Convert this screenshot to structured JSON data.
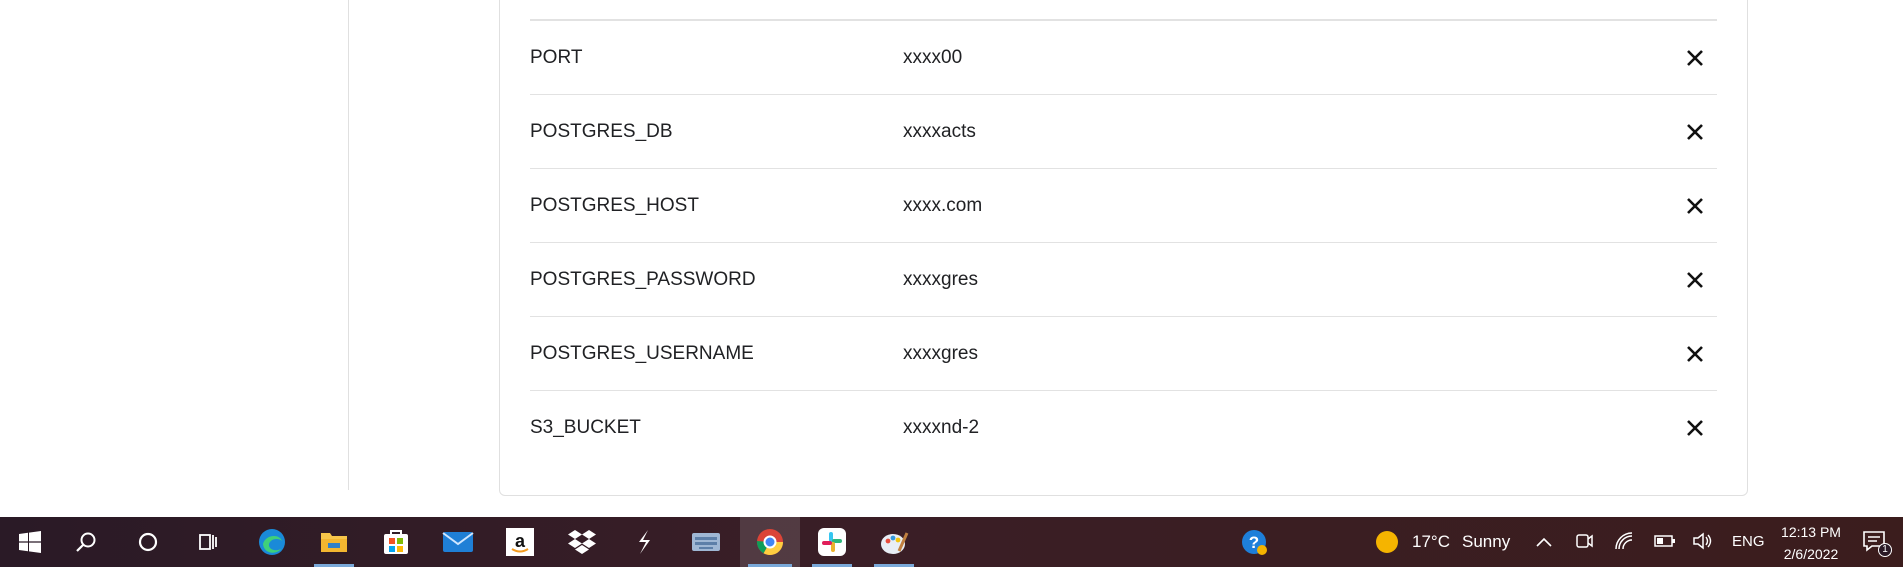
{
  "env_vars": [
    {
      "key": "PORT",
      "value": "xxxx00"
    },
    {
      "key": "POSTGRES_DB",
      "value": "xxxxacts"
    },
    {
      "key": "POSTGRES_HOST",
      "value": "xxxx.com"
    },
    {
      "key": "POSTGRES_PASSWORD",
      "value": "xxxxgres"
    },
    {
      "key": "POSTGRES_USERNAME",
      "value": "xxxxgres"
    },
    {
      "key": "S3_BUCKET",
      "value": "xxxxnd-2"
    }
  ],
  "taskbar": {
    "apps": [
      "start-icon",
      "search-icon",
      "cortana-icon",
      "task-view-icon",
      "edge-icon",
      "file-explorer-icon",
      "store-icon",
      "mail-icon",
      "amazon-icon",
      "dropbox-icon",
      "slashdot-icon",
      "keyboard-app-icon",
      "chrome-icon",
      "slack-icon",
      "paint-icon"
    ],
    "help_icon": "help-icon",
    "weather": {
      "temp": "17°C",
      "condition": "Sunny",
      "icon": "sun-icon",
      "color": "#f5b400"
    },
    "language": "ENG",
    "time": "12:13 PM",
    "date": "2/6/2022",
    "notification_count": "1"
  },
  "colors": {
    "accent_underline": "#79a8d8",
    "divider": "#e2e2e2"
  }
}
